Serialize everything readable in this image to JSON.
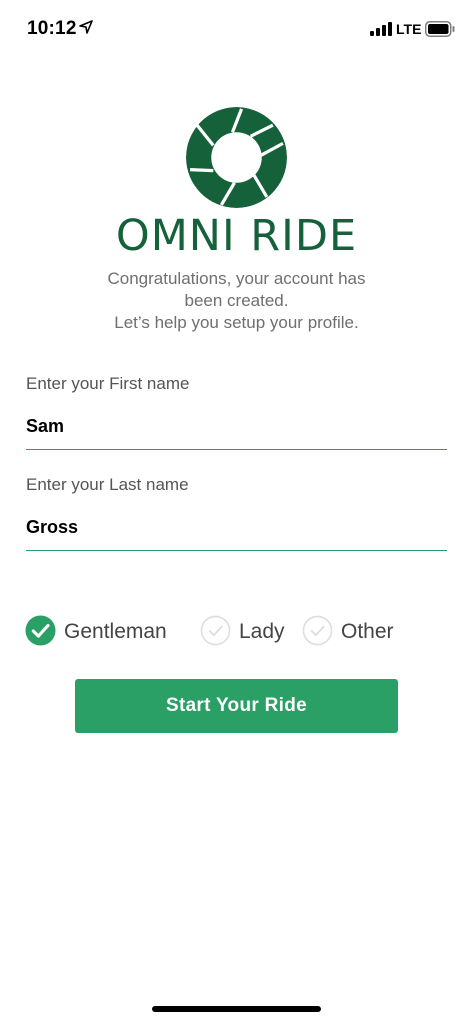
{
  "status_bar": {
    "time": "10:12",
    "network": "LTE"
  },
  "brand": {
    "name": "OMNI RIDE",
    "color": "#15613a"
  },
  "intro": {
    "line1": "Congratulations, your account has",
    "line2": "been created.",
    "line3": "Let’s help you setup your profile."
  },
  "form": {
    "first_name": {
      "label": "Enter your First name",
      "value": "Sam"
    },
    "last_name": {
      "label": "Enter your Last name",
      "value": "Gross"
    },
    "gender": {
      "selected": "Gentleman",
      "options": [
        {
          "label": "Gentleman",
          "checked": true
        },
        {
          "label": "Lady",
          "checked": false
        },
        {
          "label": "Other",
          "checked": false
        }
      ]
    }
  },
  "actions": {
    "start_label": "Start Your Ride"
  },
  "colors": {
    "accent": "#2aa066",
    "underline": "#2e9c64",
    "unchecked": "#dddddd"
  },
  "icons": {
    "location": "location-arrow-icon",
    "signal": "cellular-signal-icon",
    "battery": "battery-icon",
    "logo": "aperture-logo-icon",
    "checked": "check-circle-filled-icon",
    "unchecked": "check-circle-outline-icon"
  }
}
